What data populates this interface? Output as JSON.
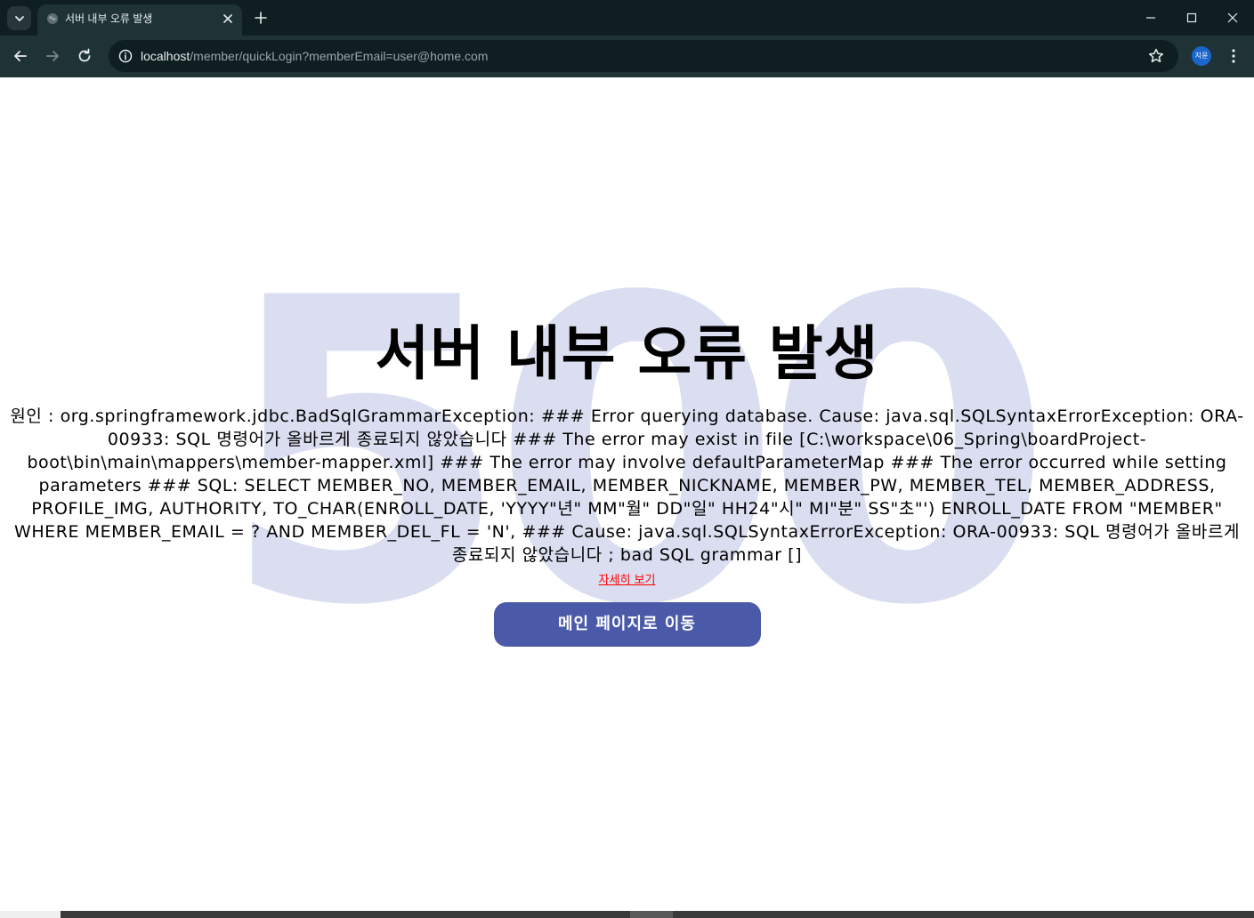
{
  "browser": {
    "tab": {
      "title": "서버 내부 오류 발생",
      "favicon": "globe-icon"
    },
    "address_bar": {
      "host": "localhost",
      "path": "/member/quickLogin?memberEmail=user@home.com"
    },
    "profile": {
      "initials": "지윤",
      "color": "#1a66cc"
    }
  },
  "page": {
    "background_number": "500",
    "title": "서버 내부 오류 발생",
    "cause": "원인 : org.springframework.jdbc.BadSqlGrammarException: ### Error querying database. Cause: java.sql.SQLSyntaxErrorException: ORA-00933: SQL 명령어가 올바르게 종료되지 않았습니다 ### The error may exist in file [C:\\workspace\\06_Spring\\boardProject-boot\\bin\\main\\mappers\\member-mapper.xml] ### The error may involve defaultParameterMap ### The error occurred while setting parameters ### SQL: SELECT MEMBER_NO, MEMBER_EMAIL, MEMBER_NICKNAME, MEMBER_PW, MEMBER_TEL, MEMBER_ADDRESS, PROFILE_IMG, AUTHORITY, TO_CHAR(ENROLL_DATE, 'YYYY\"년\" MM\"월\" DD\"일\" HH24\"시\" MI\"분\" SS\"초\"') ENROLL_DATE FROM \"MEMBER\" WHERE MEMBER_EMAIL = ? AND MEMBER_DEL_FL = 'N', ### Cause: java.sql.SQLSyntaxErrorException: ORA-00933: SQL 명령어가 올바르게 종료되지 않았습니다 ; bad SQL grammar []",
    "detail_link": "자세히 보기",
    "main_button": "메인 페이지로 이동"
  },
  "colors": {
    "accent_button": "#4a5aa8",
    "background_number": "#dadef0",
    "detail_link": "#ff0000",
    "chrome_dark": "#0f1e21",
    "chrome_toolbar": "#1f3236"
  }
}
